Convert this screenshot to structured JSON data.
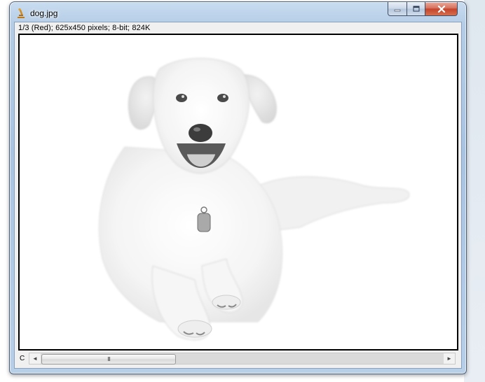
{
  "window": {
    "title": "dog.jpg",
    "caption_buttons": {
      "minimize": "minimize-icon",
      "maximize": "maximize-icon",
      "close": "close-icon"
    }
  },
  "image_info": "1/3 (Red); 625x450 pixels; 8-bit; 824K",
  "channel_label": "C",
  "scrollbar": {
    "thumb_grip": "III",
    "left_arrow": "◄",
    "right_arrow": "►"
  },
  "colors": {
    "close_button": "#c5442b",
    "frame": "#a9c4e2",
    "image_border": "#000000"
  }
}
